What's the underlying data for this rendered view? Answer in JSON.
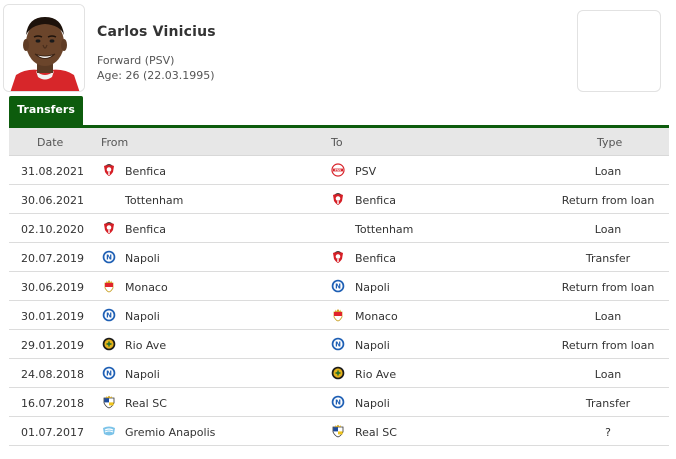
{
  "player": {
    "name": "Carlos Vinicius",
    "position": "Forward (PSV)",
    "age": "Age: 26 (22.03.1995)"
  },
  "tab": {
    "label": "Transfers"
  },
  "table": {
    "headers": {
      "date": "Date",
      "from": "From",
      "to": "To",
      "type": "Type"
    },
    "rows": [
      {
        "date": "31.08.2021",
        "from": "Benfica",
        "from_icon": "benfica",
        "to": "PSV",
        "to_icon": "psv",
        "type": "Loan"
      },
      {
        "date": "30.06.2021",
        "from": "Tottenham",
        "from_icon": "none",
        "to": "Benfica",
        "to_icon": "benfica",
        "type": "Return from loan"
      },
      {
        "date": "02.10.2020",
        "from": "Benfica",
        "from_icon": "benfica",
        "to": "Tottenham",
        "to_icon": "none",
        "type": "Loan"
      },
      {
        "date": "20.07.2019",
        "from": "Napoli",
        "from_icon": "napoli",
        "to": "Benfica",
        "to_icon": "benfica",
        "type": "Transfer"
      },
      {
        "date": "30.06.2019",
        "from": "Monaco",
        "from_icon": "monaco",
        "to": "Napoli",
        "to_icon": "napoli",
        "type": "Return from loan"
      },
      {
        "date": "30.01.2019",
        "from": "Napoli",
        "from_icon": "napoli",
        "to": "Monaco",
        "to_icon": "monaco",
        "type": "Loan"
      },
      {
        "date": "29.01.2019",
        "from": "Rio Ave",
        "from_icon": "rioave",
        "to": "Napoli",
        "to_icon": "napoli",
        "type": "Return from loan"
      },
      {
        "date": "24.08.2018",
        "from": "Napoli",
        "from_icon": "napoli",
        "to": "Rio Ave",
        "to_icon": "rioave",
        "type": "Loan"
      },
      {
        "date": "16.07.2018",
        "from": "Real SC",
        "from_icon": "realsc",
        "to": "Napoli",
        "to_icon": "napoli",
        "type": "Transfer"
      },
      {
        "date": "01.07.2017",
        "from": "Gremio Anapolis",
        "from_icon": "gremio",
        "to": "Real SC",
        "to_icon": "realsc",
        "type": "?"
      }
    ]
  },
  "colors": {
    "tab": "#0d5c0d",
    "header_bg": "#e7e7e7"
  }
}
